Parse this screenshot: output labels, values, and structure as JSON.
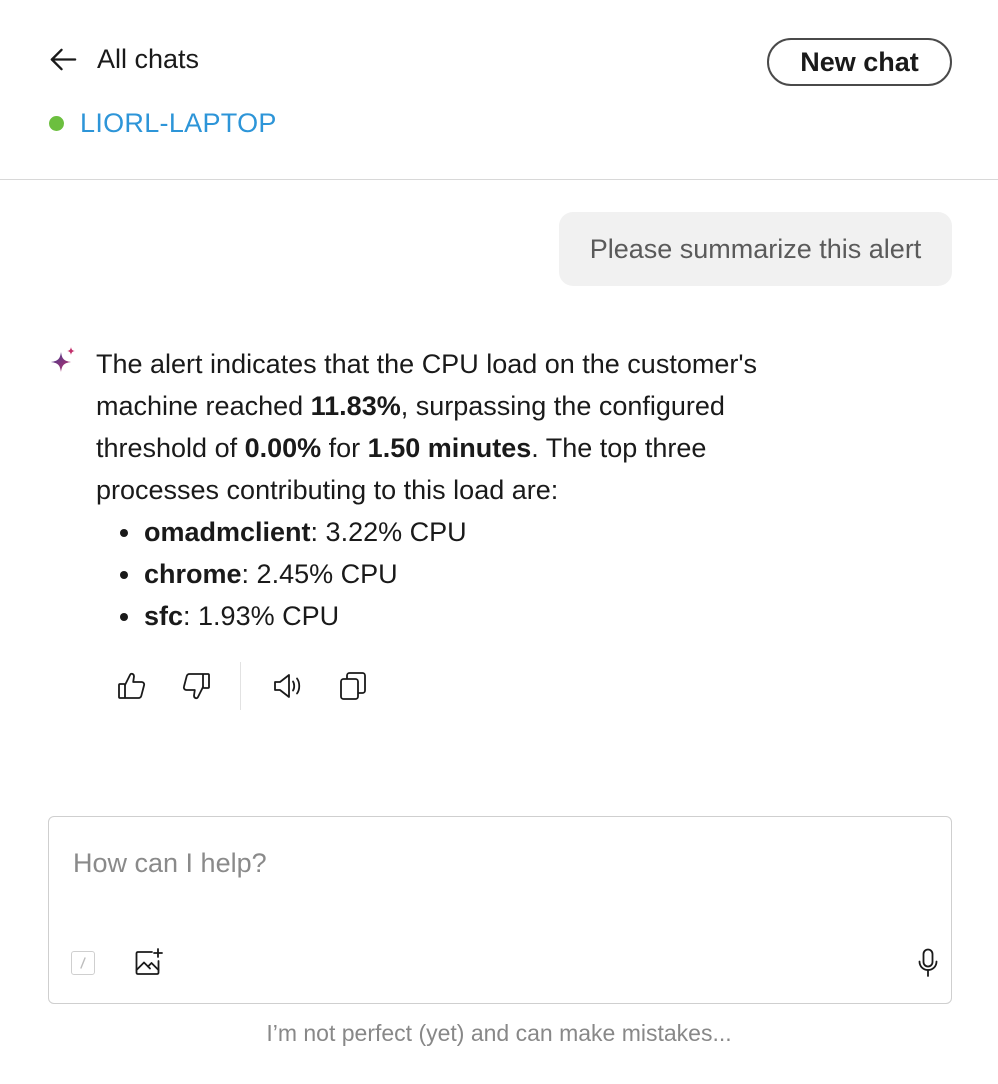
{
  "header": {
    "back_label": "All chats",
    "new_chat_label": "New chat",
    "device": {
      "name": "LIORL-LAPTOP",
      "status_color": "#6cbf3f"
    }
  },
  "conversation": {
    "user_message": "Please summarize this alert",
    "assistant": {
      "intro_1": "The alert indicates that the CPU load on the customer's machine reached ",
      "cpu_load": "11.83%",
      "intro_2": ", surpassing the configured threshold of ",
      "threshold": "0.00%",
      "intro_3": " for ",
      "duration": "1.50 minutes",
      "intro_4": ". The top three processes contributing to this load are:",
      "processes": [
        {
          "name": "omadmclient",
          "value": ": 3.22% CPU"
        },
        {
          "name": "chrome",
          "value": ": 2.45% CPU"
        },
        {
          "name": "sfc",
          "value": ": 1.93% CPU"
        }
      ]
    },
    "actions": [
      "thumbs-up-icon",
      "thumbs-down-icon",
      "speaker-icon",
      "copy-icon"
    ]
  },
  "composer": {
    "placeholder": "How can I help?",
    "value": ""
  },
  "disclaimer": "I’m not perfect (yet) and can make mistakes...",
  "colors": {
    "accent_link": "#2d95d8",
    "status_online": "#6cbf3f",
    "bubble_bg": "#f1f1f1"
  }
}
